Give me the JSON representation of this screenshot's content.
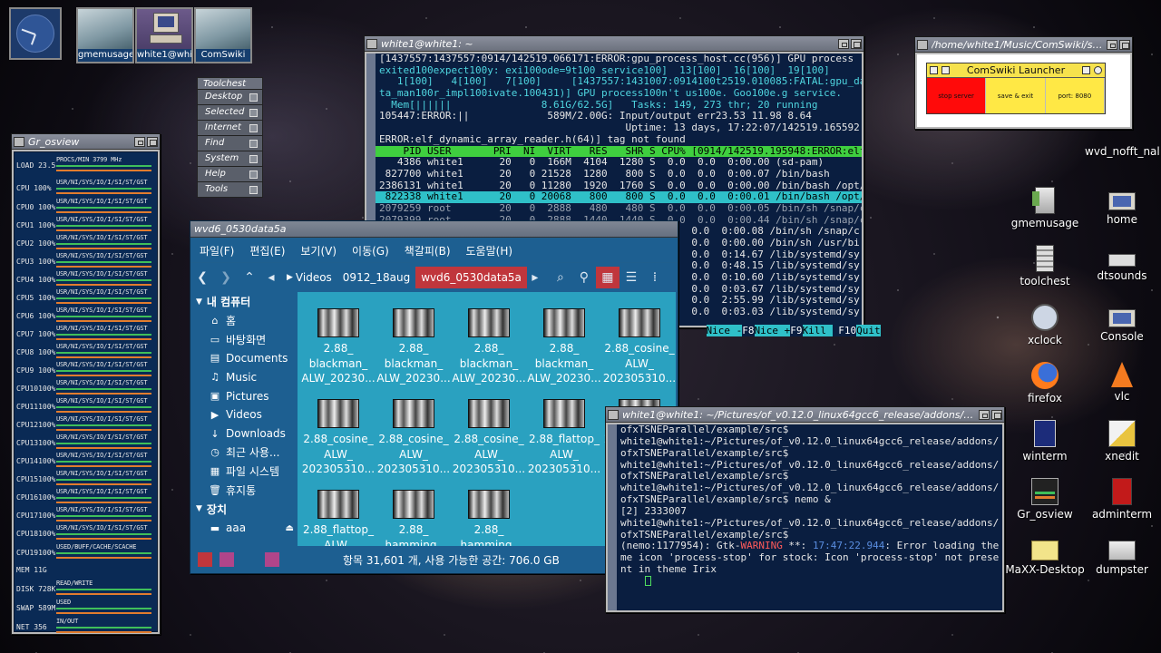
{
  "taskbar": {
    "thumbs": [
      {
        "label": "gmemusage@whi"
      },
      {
        "label": "white1@white1:"
      },
      {
        "label": "ComSwiki"
      }
    ]
  },
  "toolchest": {
    "title": "Toolchest",
    "items": [
      "Desktop",
      "Selected",
      "Internet",
      "Find",
      "System",
      "Help",
      "Tools"
    ]
  },
  "osview": {
    "title": "Gr_osview",
    "rows": [
      {
        "label": "LOAD 23.5",
        "key": "PROCS/MIN  3799 MHz"
      },
      {
        "label": "CPU  100%",
        "key": "USR/NI/SYS/IO/I/SI/ST/GST"
      },
      {
        "label": "CPU0 100%",
        "key": "USR/NI/SYS/IO/I/SI/ST/GST"
      },
      {
        "label": "CPU1 100%",
        "key": "USR/NI/SYS/IO/I/SI/ST/GST"
      },
      {
        "label": "CPU2 100%",
        "key": "USR/NI/SYS/IO/I/SI/ST/GST"
      },
      {
        "label": "CPU3 100%",
        "key": "USR/NI/SYS/IO/I/SI/ST/GST"
      },
      {
        "label": "CPU4 100%",
        "key": "USR/NI/SYS/IO/I/SI/ST/GST"
      },
      {
        "label": "CPU5 100%",
        "key": "USR/NI/SYS/IO/I/SI/ST/GST"
      },
      {
        "label": "CPU6 100%",
        "key": "USR/NI/SYS/IO/I/SI/ST/GST"
      },
      {
        "label": "CPU7 100%",
        "key": "USR/NI/SYS/IO/I/SI/ST/GST"
      },
      {
        "label": "CPU8 100%",
        "key": "USR/NI/SYS/IO/I/SI/ST/GST"
      },
      {
        "label": "CPU9 100%",
        "key": "USR/NI/SYS/IO/I/SI/ST/GST"
      },
      {
        "label": "CPU10100%",
        "key": "USR/NI/SYS/IO/I/SI/ST/GST"
      },
      {
        "label": "CPU11100%",
        "key": "USR/NI/SYS/IO/I/SI/ST/GST"
      },
      {
        "label": "CPU12100%",
        "key": "USR/NI/SYS/IO/I/SI/ST/GST"
      },
      {
        "label": "CPU13100%",
        "key": "USR/NI/SYS/IO/I/SI/ST/GST"
      },
      {
        "label": "CPU14100%",
        "key": "USR/NI/SYS/IO/I/SI/ST/GST"
      },
      {
        "label": "CPU15100%",
        "key": "USR/NI/SYS/IO/I/SI/ST/GST"
      },
      {
        "label": "CPU16100%",
        "key": "USR/NI/SYS/IO/I/SI/ST/GST"
      },
      {
        "label": "CPU17100%",
        "key": "USR/NI/SYS/IO/I/SI/ST/GST"
      },
      {
        "label": "CPU18100%",
        "key": "USR/NI/SYS/IO/I/SI/ST/GST"
      },
      {
        "label": "CPU19100%",
        "key": "USED/BUFF/CACHE/SCACHE"
      },
      {
        "label": "MEM   11G",
        "key": ""
      },
      {
        "label": "DISK 728K",
        "key": "READ/WRITE"
      },
      {
        "label": "SWAP 589M",
        "key": "USED"
      },
      {
        "label": "NET  356",
        "key": "IN/OUT"
      }
    ]
  },
  "htop": {
    "title": "white1@white1: ~",
    "lines": [
      "[1437557:1437557:0914/142519.066171:ERROR:gpu_process_host.cc(956)] GPU process",
      "exited100expect100y: exi100ode=9t100 service100]  13[100]  16[100]  19[100]",
      "   1[100]   4[100]   7[100]     [1437557:1431007:0914100t2519.010085:FATAL:gpu_da",
      "ta_man100r_impl100ivate.100431)] GPU process100n't us100e. Goo100e.g service.",
      "  Mem[||||||               8.61G/62.5G]   Tasks: 149, 273 thr; 20 running",
      "105447:ERROR:||             589M/2.00G: Input/output err23.53 11.98 8.64",
      "                                         Uptime: 13 days, 17:22:07/142519.165592:",
      "ERROR:elf_dynamic_array_reader.h(64)] tag not found",
      "    PID USER       PRI  NI  VIRT   RES   SHR S CPU% [0914/142519.195948:ERROR:elf",
      "   4386 white1      20   0  166M  4104  1280 S  0.0  0.0  0:00.00 (sd-pam)",
      " 827700 white1      20   0 21528  1280   800 S  0.0  0.0  0:00.07 /bin/bash",
      "2386131 white1      20   0 11280  1920  1760 S  0.0  0.0  0:00.00 /bin/bash /opt/",
      " 822338 white1      20   0 20068   800   800 S  0.0  0.0  0:00.01 /bin/bash /opt/",
      "2079259 root        20   0  2888   480   480 S  0.0  0.0  0:00.05 /bin/sh /snap/c",
      "2079399 root        20   0  2888  1440  1440 S  0.0  0.0  0:00.44 /bin/sh /snap/c",
      "                                                    0.0  0:00.08 /bin/sh /snap/c",
      "                                                    0.0  0:00.00 /bin/sh /usr/bi",
      "                                                    0.0  0:14.67 /lib/systemd/sy",
      "                                                    0.0  0:48.15 /lib/systemd/sy",
      "                                                    0.0  0:10.60 /lib/systemd/sy",
      "                                                    0.0  0:03.67 /lib/systemd/sy",
      "                                                    0.0  2:55.99 /lib/systemd/sy",
      "                                                    0.0  0:03.03 /lib/systemd/sy"
    ],
    "fkeys": [
      {
        "key": "",
        "val": "Nice -"
      },
      {
        "key": "F8",
        "val": "Nice +"
      },
      {
        "key": "F9",
        "val": "Kill "
      },
      {
        "key": " F10",
        "val": "Quit"
      }
    ]
  },
  "nemo": {
    "title": "wvd6_0530data5a",
    "menu": [
      "파일(F)",
      "편집(E)",
      "보기(V)",
      "이동(G)",
      "책갈피(B)",
      "도움말(H)"
    ],
    "breadcrumbs": [
      "Videos",
      "0912_18aug",
      "wvd6_0530data5a"
    ],
    "sidebar": {
      "computer_head": "내 컴퓨터",
      "items": [
        {
          "icon": "⌂",
          "label": "홈"
        },
        {
          "icon": "▭",
          "label": "바탕화면"
        },
        {
          "icon": "▤",
          "label": "Documents"
        },
        {
          "icon": "♫",
          "label": "Music"
        },
        {
          "icon": "▣",
          "label": "Pictures"
        },
        {
          "icon": "▶",
          "label": "Videos"
        },
        {
          "icon": "↓",
          "label": "Downloads"
        },
        {
          "icon": "◷",
          "label": "최근 사용..."
        },
        {
          "icon": "▦",
          "label": "파일 시스템"
        },
        {
          "icon": "🗑",
          "label": "휴지통"
        }
      ],
      "devices_head": "장치",
      "devices": [
        {
          "icon": "▬",
          "label": "aaa"
        }
      ]
    },
    "files": [
      {
        "l1": "2.88_",
        "l2": "blackman_",
        "l3": "ALW_20230..."
      },
      {
        "l1": "2.88_",
        "l2": "blackman_",
        "l3": "ALW_20230..."
      },
      {
        "l1": "2.88_",
        "l2": "blackman_",
        "l3": "ALW_20230..."
      },
      {
        "l1": "2.88_",
        "l2": "blackman_",
        "l3": "ALW_20230..."
      },
      {
        "l1": "2.88_cosine_",
        "l2": "ALW_",
        "l3": "202305310..."
      },
      {
        "l1": "2.88_cosine_",
        "l2": "ALW_",
        "l3": "202305310..."
      },
      {
        "l1": "2.88_cosine_",
        "l2": "ALW_",
        "l3": "202305310..."
      },
      {
        "l1": "2.88_cosine_",
        "l2": "ALW_",
        "l3": "202305310..."
      },
      {
        "l1": "2.88_flattop_",
        "l2": "ALW_",
        "l3": "202305310..."
      },
      {
        "l1": "2.88_flattop_",
        "l2": "ALW_",
        "l3": ""
      },
      {
        "l1": "2.88_flattop_",
        "l2": "ALW_",
        "l3": ""
      },
      {
        "l1": "2.88_",
        "l2": "hamming_",
        "l3": ""
      },
      {
        "l1": "2.88_",
        "l2": "hamming_",
        "l3": ""
      }
    ],
    "status": "항목 31,601 개, 사용 가능한 공간: 706.0 GB"
  },
  "term2": {
    "title": "white1@white1: ~/Pictures/of_v0.12.0_linux64gcc6_release/addons/ofxTSNEParallel/example/src",
    "lines": [
      "ofxTSNEParallel/example/src$",
      "white1@white1:~/Pictures/of_v0.12.0_linux64gcc6_release/addons/",
      "ofxTSNEParallel/example/src$",
      "white1@white1:~/Pictures/of_v0.12.0_linux64gcc6_release/addons/",
      "ofxTSNEParallel/example/src$",
      "white1@white1:~/Pictures/of_v0.12.0_linux64gcc6_release/addons/",
      "ofxTSNEParallel/example/src$ nemo &",
      "[2] 2333007",
      "white1@white1:~/Pictures/of_v0.12.0_linux64gcc6_release/addons/",
      "ofxTSNEParallel/example/src$"
    ],
    "warn_prefix": "(nemo:1177954): Gtk-",
    "warn_word": "WARNING",
    "warn_mid": " **: ",
    "warn_time": "17:47:22.944",
    "warn_rest": ": Error loading the",
    "warn_line2": "me icon 'process-stop' for stock: Icon 'process-stop' not prese",
    "warn_line3": "nt in theme Irix"
  },
  "comswiki": {
    "title": "/home/white1/Music/ComSwiki/squeak...",
    "launcher_title": "ComSwiki Launcher",
    "stop": "stop server",
    "save": "save & exit",
    "port": "port: 8080"
  },
  "desktop_icons": {
    "nofft": "wvd_nofft_nal",
    "items": [
      {
        "label": "gmemusage",
        "glyph": "doc"
      },
      {
        "label": "home",
        "glyph": "pc2"
      },
      {
        "label": "toolchest",
        "glyph": "tools"
      },
      {
        "label": "dtsounds",
        "glyph": "sounds"
      },
      {
        "label": "xclock",
        "glyph": "clock2"
      },
      {
        "label": "Console",
        "glyph": "pc2"
      },
      {
        "label": "firefox",
        "glyph": "fox"
      },
      {
        "label": "vlc",
        "glyph": "cone"
      },
      {
        "label": "winterm",
        "glyph": "term"
      },
      {
        "label": "xnedit",
        "glyph": "pen"
      },
      {
        "label": "Gr_osview",
        "glyph": "graph"
      },
      {
        "label": "adminterm",
        "glyph": "red"
      },
      {
        "label": "MaXX-Desktop",
        "glyph": "folder"
      },
      {
        "label": "dumpster",
        "glyph": "dump"
      }
    ]
  }
}
